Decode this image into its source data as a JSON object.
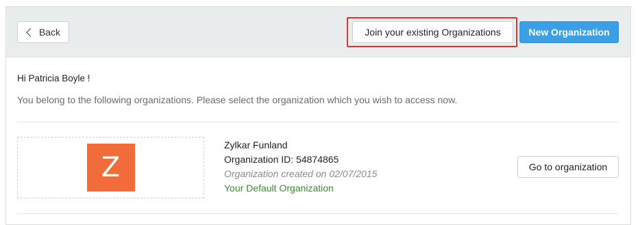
{
  "header": {
    "back_label": "Back",
    "join_label": "Join your existing Organizations",
    "new_org_label": "New Organization"
  },
  "main": {
    "greeting": "Hi Patricia Boyle !",
    "info": "You belong to the following organizations. Please select the organization which you wish to access now."
  },
  "organizations": [
    {
      "logo_letter": "Z",
      "logo_color": "#f26b3a",
      "name": "Zylkar Funland",
      "id_text": "Organization ID: 54874865",
      "created_text": "Organization created on 02/07/2015",
      "default_text": "Your Default Organization",
      "action_label": "Go to organization"
    }
  ],
  "colors": {
    "accent": "#3d9fe3",
    "highlight": "#e8312c",
    "default_green": "#3c8a2e",
    "header_bg": "#e9eded"
  },
  "icons": {
    "back": "chevron-left-icon"
  }
}
